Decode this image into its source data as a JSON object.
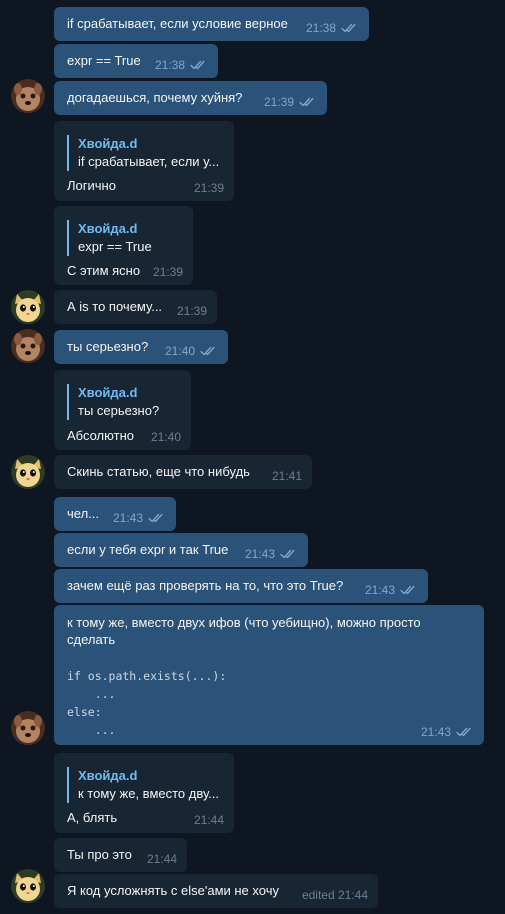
{
  "colors": {
    "background": "#0e1621",
    "outgoing_bubble": "#2b5278",
    "incoming_bubble": "#182533",
    "accent": "#71baf2"
  },
  "messages": [
    {
      "text": "if срабатывает, если условие верное",
      "time": "21:38"
    },
    {
      "text": "expr == True",
      "time": "21:38"
    },
    {
      "text": "догадаешься, почему хуйня?",
      "time": "21:39"
    },
    {
      "quote_name": "Хвойда.d",
      "quote_text": "if срабатывает, если у...",
      "text": "Логично",
      "time": "21:39"
    },
    {
      "quote_name": "Хвойда.d",
      "quote_text": "expr == True",
      "text": "С этим ясно",
      "time": "21:39"
    },
    {
      "text": "А is то почему...",
      "time": "21:39"
    },
    {
      "text": "ты серьезно?",
      "time": "21:40"
    },
    {
      "quote_name": "Хвойда.d",
      "quote_text": "ты серьезно?",
      "text": "Абсолютно",
      "time": "21:40"
    },
    {
      "text": "Скинь статью, еще что нибудь",
      "time": "21:41"
    },
    {
      "text": "чел...",
      "time": "21:43"
    },
    {
      "text": "если у тебя expr и так True",
      "time": "21:43"
    },
    {
      "text": "зачем ещё раз проверять на то, что это True?",
      "time": "21:43"
    },
    {
      "text": "к тому же, вместо двух ифов (что уебищно), можно просто сделать",
      "code": "if os.path.exists(...):\n    ...\nelse:\n    ...",
      "time": "21:43"
    },
    {
      "quote_name": "Хвойда.d",
      "quote_text": "к тому же, вместо дву...",
      "text": "А, блять",
      "time": "21:44"
    },
    {
      "text": "Ты про это",
      "time": "21:44"
    },
    {
      "text": "Я код усложнять с else'ами не хочу",
      "time": "edited 21:44"
    }
  ]
}
